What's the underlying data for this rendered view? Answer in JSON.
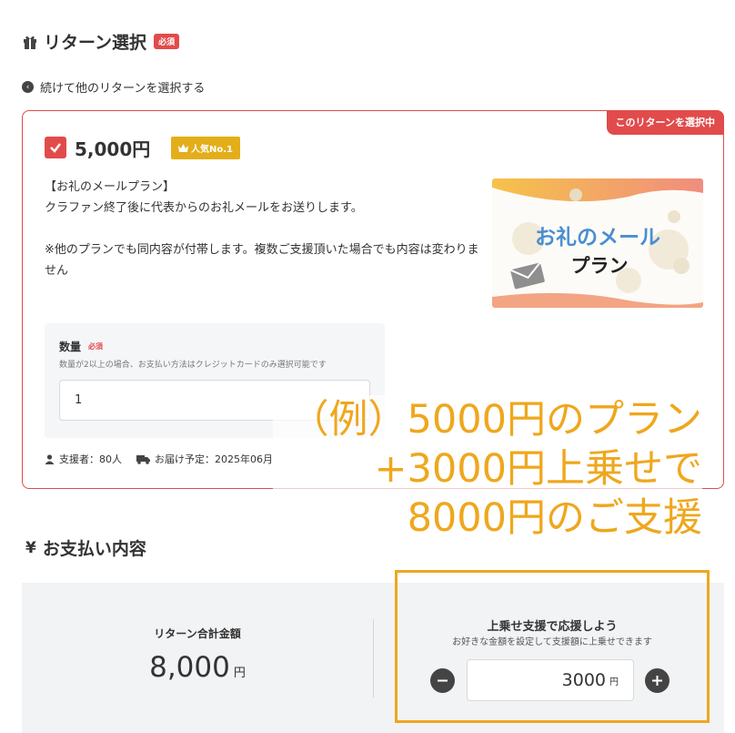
{
  "return_section": {
    "title": "リターン選択",
    "required_badge": "必須",
    "icon": "gift-icon",
    "back_link": "続けて他のリターンを選択する"
  },
  "reward_card": {
    "selected_label": "このリターンを選択中",
    "price": "5,000円",
    "popular_badge": "人気No.1",
    "description": [
      "【お礼のメールプラン】",
      "クラファン終了後に代表からのお礼メールをお送りします。",
      "",
      "※他のプランでも同内容が付帯します。複数ご支援頂いた場合でも内容は変わりません"
    ],
    "image": {
      "line1": "お礼のメール",
      "line2": "プラン"
    },
    "quantity": {
      "label": "数量",
      "required": "必須",
      "note": "数量が2以上の場合、お支払い方法はクレジットカードのみ選択可能です",
      "value": "1"
    },
    "supporters": "支援者：80人",
    "delivery": "お届け予定：2025年06月"
  },
  "overlay_text": [
    "（例）5000円のプラン",
    "+3000円上乗せで",
    "8000円のご支援"
  ],
  "payment": {
    "title": "お支払い内容",
    "total_label": "リターン合計金額",
    "total_value": "8,000",
    "total_unit": "円",
    "extra_title": "上乗せ支援で応援しよう",
    "extra_sub": "お好きな金額を設定して支援額に上乗せできます",
    "extra_value": "3000",
    "extra_unit": "円"
  },
  "colors": {
    "accent_red": "#e24b4b",
    "highlight_orange": "#efa71d",
    "badge_gold": "#e3ae1a"
  }
}
